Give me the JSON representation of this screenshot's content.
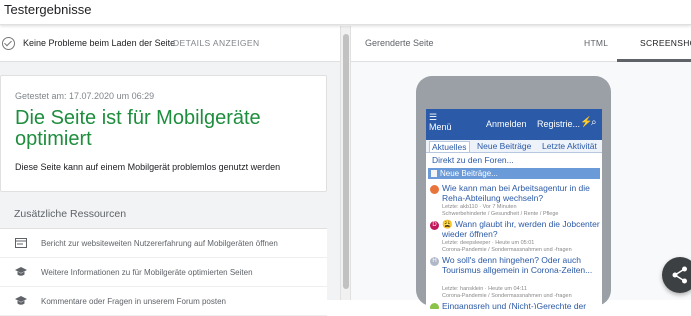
{
  "header": {
    "title": "Testergebnisse"
  },
  "status": {
    "message": "Keine Probleme beim Laden der Seite",
    "details_label": "DETAILS ANZEIGEN"
  },
  "result": {
    "tested": "Getestet am: 17.07.2020 um 06:29",
    "headline": "Die Seite ist für Mobilgeräte optimiert",
    "description": "Diese Seite kann auf einem Mobilgerät problemlos genutzt werden"
  },
  "resources": {
    "title": "Zusätzliche Ressourcen",
    "items": [
      {
        "icon": "report-icon",
        "label": "Bericht zur websiteweiten Nutzererfahrung auf Mobilgeräten öffnen"
      },
      {
        "icon": "graduation-cap-icon",
        "label": "Weitere Informationen zu für Mobilgeräte optimierten Seiten"
      },
      {
        "icon": "graduation-cap-icon",
        "label": "Kommentare oder Fragen in unserem Forum posten"
      }
    ]
  },
  "preview": {
    "label": "Gerenderte Seite",
    "tabs": [
      "HTML",
      "SCREENSHOT"
    ],
    "active_tab": "SCREENSHOT"
  },
  "phone": {
    "nav": {
      "menu": "☰",
      "menu_label": "Menü",
      "login": "Anmelden",
      "register": "Registrie...",
      "icon1": "⚡",
      "icon2": "⌕"
    },
    "subtabs": [
      "Aktuelles",
      "Neue Beiträge",
      "Letzte Aktivität"
    ],
    "jump": "Direkt zu den Foren...",
    "new_posts": "Neue Beiträge...",
    "posts": [
      {
        "title": "Wie kann man bei Arbeitsagentur in die Reha-Abteilung wechseln?",
        "meta1": "Letzte: akb110 · Vor 7 Minuten",
        "meta2": "Schwerbehinderte / Gesundheit / Rente / Pflege",
        "avatar": "#e8743b",
        "avatar_text": ""
      },
      {
        "title": "😩 Wann glaubt ihr, werden die Jobcenter wieder öffnen?",
        "meta1": "Letzte: deepsleeper · Heute um 05:01",
        "meta2": "Corona-Pandemie / Sondermassnahmen und -fragen",
        "avatar": "#c2185b",
        "avatar_text": "D"
      },
      {
        "title": "Wo soll's denn hingehen? Oder auch Tourismus allgemein in Corona-Zeiten...",
        "meta1": "Letzte: hansklein · Heute um 04:11",
        "meta2": "Corona-Pandemie / Sondermassnahmen und -fragen",
        "avatar": "#b0b8c8",
        "avatar_text": "H"
      },
      {
        "title": "Eingangsreh und (Nicht-)Gerechte der",
        "meta1": "",
        "meta2": "",
        "avatar": "#8bc34a",
        "avatar_text": ""
      }
    ]
  },
  "colors": {
    "success": "#1e8e3e",
    "nav": "#2b5aa8",
    "link": "#2b5aa8"
  }
}
